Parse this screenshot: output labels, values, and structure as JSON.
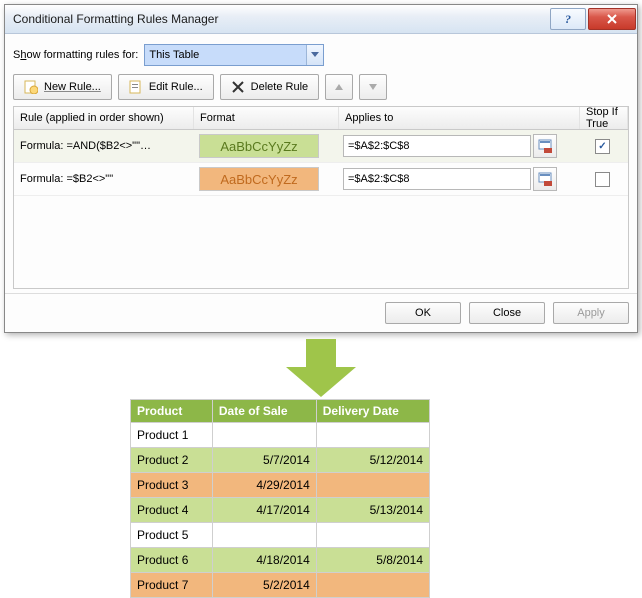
{
  "dialog": {
    "title": "Conditional Formatting Rules Manager",
    "show_label_pre": "S",
    "show_label_ul": "h",
    "show_label_post": "ow formatting rules for:",
    "scope": "This Table",
    "buttons": {
      "new": "New Rule...",
      "edit": "Edit Rule...",
      "delete": "Delete Rule"
    },
    "headers": {
      "rule": "Rule (applied in order shown)",
      "format": "Format",
      "applies": "Applies to",
      "stop": "Stop If True"
    },
    "rules": [
      {
        "formula": "Formula: =AND($B2<>\"\"…",
        "preview": "AaBbCcYyZz",
        "pv_class": "pv-green",
        "applies": "=$A$2:$C$8",
        "stop": true
      },
      {
        "formula": "Formula: =$B2<>\"\"",
        "preview": "AaBbCcYyZz",
        "pv_class": "pv-orange",
        "applies": "=$A$2:$C$8",
        "stop": false
      }
    ],
    "footer": {
      "ok": "OK",
      "close": "Close",
      "apply": "Apply"
    }
  },
  "sheet": {
    "headers": [
      "Product",
      "Date of Sale",
      "Delivery Date"
    ],
    "rows": [
      {
        "cls": "",
        "cells": [
          "Product 1",
          "",
          ""
        ]
      },
      {
        "cls": "g",
        "cells": [
          "Product 2",
          "5/7/2014",
          "5/12/2014"
        ]
      },
      {
        "cls": "o",
        "cells": [
          "Product 3",
          "4/29/2014",
          ""
        ]
      },
      {
        "cls": "g",
        "cells": [
          "Product 4",
          "4/17/2014",
          "5/13/2014"
        ]
      },
      {
        "cls": "",
        "cells": [
          "Product 5",
          "",
          ""
        ]
      },
      {
        "cls": "g",
        "cells": [
          "Product 6",
          "4/18/2014",
          "5/8/2014"
        ]
      },
      {
        "cls": "o",
        "cells": [
          "Product 7",
          "5/2/2014",
          ""
        ]
      }
    ]
  },
  "chart_data": {
    "type": "table",
    "title": "Conditional formatting result",
    "columns": [
      "Product",
      "Date of Sale",
      "Delivery Date"
    ],
    "rows": [
      [
        "Product 1",
        null,
        null
      ],
      [
        "Product 2",
        "5/7/2014",
        "5/12/2014"
      ],
      [
        "Product 3",
        "4/29/2014",
        null
      ],
      [
        "Product 4",
        "4/17/2014",
        "5/13/2014"
      ],
      [
        "Product 5",
        null,
        null
      ],
      [
        "Product 6",
        "4/18/2014",
        "5/8/2014"
      ],
      [
        "Product 7",
        "5/2/2014",
        null
      ]
    ]
  }
}
